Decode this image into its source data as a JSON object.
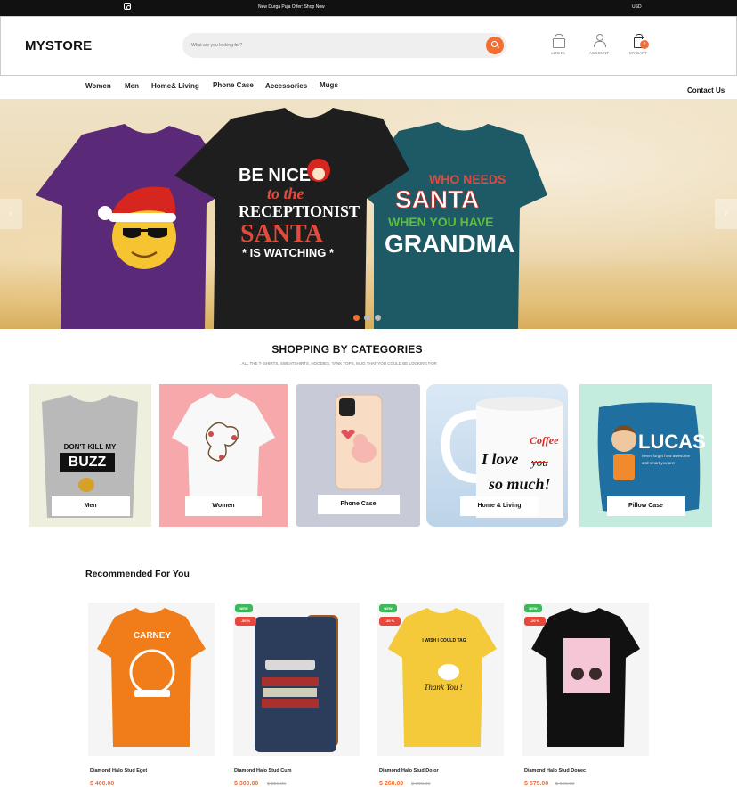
{
  "topbar": {
    "promo": "New Durga Puja Offer: Shop Now",
    "currency": "USD",
    "social_icon": "instagram-icon"
  },
  "header": {
    "logo": "MYSTORE",
    "search_placeholder": "What are you looking for?",
    "login_label": "LOG IN",
    "account_label": "ACCOUNT",
    "cart_label": "MY CART",
    "cart_count": "0"
  },
  "nav": {
    "items": [
      "Women",
      "Men",
      "Home& Living",
      "Phone Case",
      "Accessories",
      "Mugs"
    ],
    "contact": "Contact Us"
  },
  "hero": {
    "shirt_center_text": [
      "BE NICE",
      "to the",
      "RECEPTIONIST",
      "SANTA",
      "* IS WATCHING *"
    ],
    "shirt_right_text": [
      "WHO NEEDS",
      "SANTA",
      "WHEN YOU HAVE",
      "GRANDMA"
    ],
    "colors": {
      "purple": "#5a2a78",
      "black": "#1e1e1e",
      "teal": "#1d5a66",
      "accent": "#f26f34"
    },
    "slides": 3,
    "active_slide": 1
  },
  "categories": {
    "title": "SHOPPING BY CATEGORIES",
    "subtitle": ", ALL THE T- SHIRTS, SWEATSHIRTS, HOODIES, TANK TOPS, MUG THAT YOU COULD BE LOOKING FOR",
    "items": [
      {
        "label": "Men",
        "art_text": [
          "DON'T KILL MY",
          "BUZZ"
        ]
      },
      {
        "label": "Women"
      },
      {
        "label": "Phone Case"
      },
      {
        "label": "Home & Living",
        "art_text": [
          "I love",
          "Coffee",
          "you",
          "so much!"
        ]
      },
      {
        "label": "Pillow Case",
        "art_text": [
          "LUCAS",
          "never forget how awesome",
          "and smart you are!"
        ]
      }
    ]
  },
  "recommended": {
    "title": "Recommended For You",
    "products": [
      {
        "name": "Diamond Halo Stud Eget",
        "price": "$ 400.00",
        "old_price": "",
        "badges": [],
        "art_text": [
          "CARNEY"
        ]
      },
      {
        "name": "Diamond Halo Stud Cum",
        "price": "$ 300.00",
        "old_price": "$ 350.00",
        "badges": [
          "NEW",
          "-50 %"
        ]
      },
      {
        "name": "Diamond Halo Stud Dolor",
        "price": "$ 260.00",
        "old_price": "$ 300.00",
        "badges": [
          "NEW",
          "-30 %"
        ],
        "art_text": [
          "I WISH I COULD TAG",
          "Thank You !"
        ]
      },
      {
        "name": "Diamond Halo Stud Donec",
        "price": "$ 575.00",
        "old_price": "$ 600.00",
        "badges": [
          "NEW",
          "-20 %"
        ]
      }
    ]
  }
}
